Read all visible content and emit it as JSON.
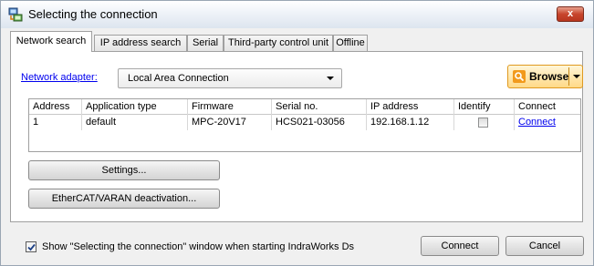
{
  "window": {
    "title": "Selecting the connection",
    "close_symbol": "x",
    "icon": "network-app-icon"
  },
  "tabs": [
    {
      "label": "Network search",
      "active": true
    },
    {
      "label": "IP address search",
      "active": false
    },
    {
      "label": "Serial",
      "active": false
    },
    {
      "label": "Third-party control unit",
      "active": false
    },
    {
      "label": "Offline",
      "active": false
    }
  ],
  "adapter": {
    "label": "Network adapter:",
    "value": "Local Area Connection"
  },
  "browse": {
    "label": "Browse",
    "icon": "search-icon"
  },
  "table": {
    "columns": [
      "Address",
      "Application type",
      "Firmware",
      "Serial no.",
      "IP address",
      "Identify",
      "Connect"
    ],
    "rows": [
      {
        "address": "1",
        "app_type": "default",
        "firmware": "MPC-20V17",
        "serial": "HCS021-03056",
        "ip": "192.168.1.12",
        "identify": false,
        "connect": "Connect"
      }
    ]
  },
  "buttons": {
    "settings": "Settings...",
    "deactivation": "EtherCAT/VARAN deactivation...",
    "connect": "Connect",
    "cancel": "Cancel"
  },
  "footer": {
    "checkbox_checked": true,
    "checkbox_label": "Show \"Selecting the connection\" window when starting IndraWorks Ds"
  },
  "colors": {
    "link": "#0000ee",
    "browse_accent": "#f29a1c",
    "close_button": "#c7452d"
  }
}
